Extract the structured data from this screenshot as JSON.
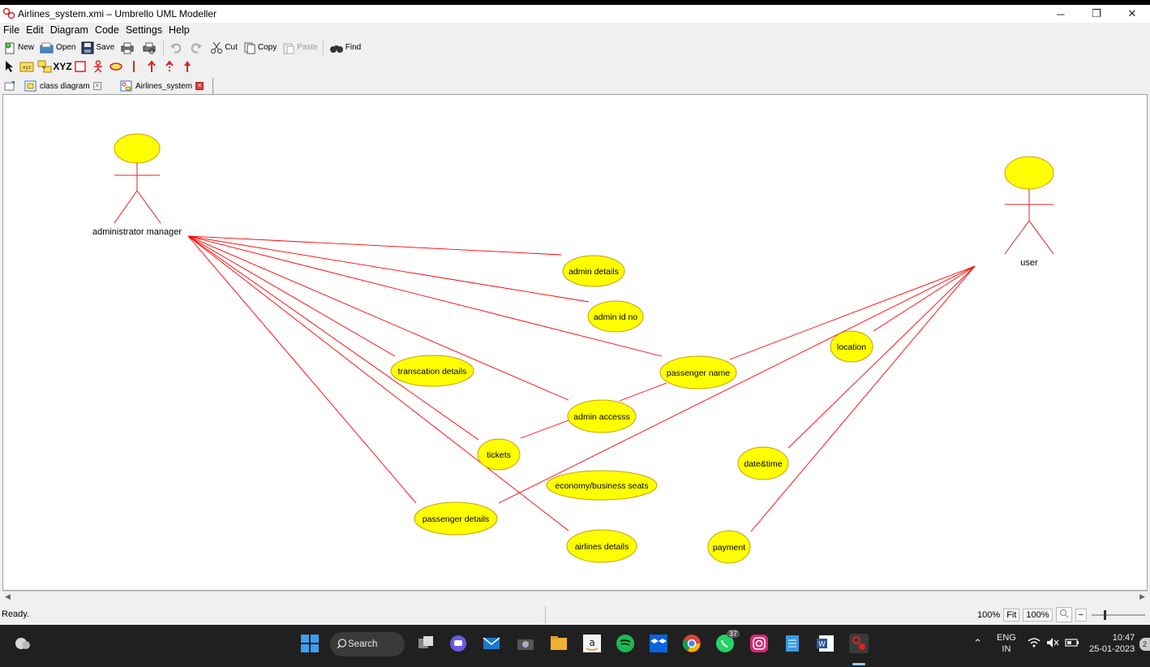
{
  "window": {
    "title": "Airlines_system.xmi – Umbrello UML Modeller",
    "controls": [
      "minimize",
      "restore",
      "close"
    ]
  },
  "menu": [
    "File",
    "Edit",
    "Diagram",
    "Code",
    "Settings",
    "Help"
  ],
  "toolbar": {
    "new": "New",
    "open": "Open",
    "save": "Save",
    "cut": "Cut",
    "copy": "Copy",
    "paste": "Paste",
    "find": "Find"
  },
  "tools": {
    "text_tool": "XYZ"
  },
  "tabs": [
    {
      "label": "class diagram",
      "active": false
    },
    {
      "label": "Airlines_system",
      "active": true
    }
  ],
  "diagram": {
    "actors": {
      "admin": "administrator manager",
      "user": "user"
    },
    "usecases": {
      "admin_details": "admin details",
      "admin_id_no": "admin id no",
      "transaction_details": "transcation details",
      "passenger_name": "passenger name",
      "admin_access": "admin accesss",
      "location": "location",
      "tickets": "tickets",
      "economy_business_seats": "economy/business seats",
      "date_time": "date&time",
      "passenger_details": "passenger details",
      "airlines_details": "airlines details",
      "payment": "payment"
    },
    "colors": {
      "usecase_fill": "#ffff00",
      "usecase_stroke": "#c8a000",
      "association": "#ff0000",
      "actor": "#ff0000"
    }
  },
  "status": {
    "text": "Ready.",
    "zoom_left": "100%",
    "fit": "Fit",
    "zoom_right": "100%"
  },
  "taskbar": {
    "search_label": "Search",
    "whatsapp_badge": "37",
    "lang_line1": "ENG",
    "lang_line2": "IN",
    "time": "10:47",
    "date": "25-01-2023",
    "notification_count": "2"
  }
}
